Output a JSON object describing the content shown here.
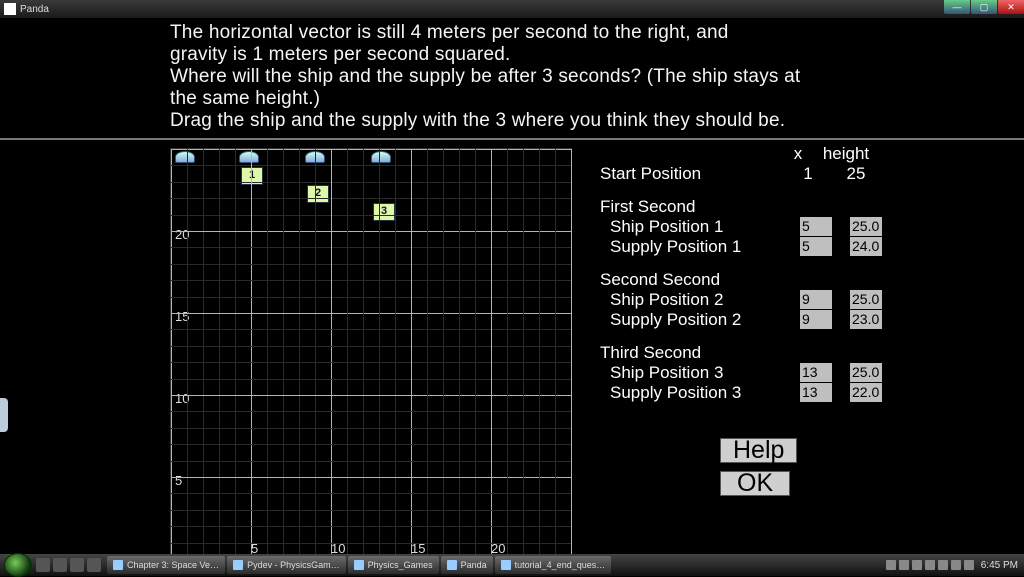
{
  "window": {
    "title": "Panda"
  },
  "question": {
    "line1": "The horizontal vector is still 4  meters per second to the right, and",
    "line2": "gravity is 1  meters per second squared.",
    "line3": "Where will the ship and the supply be after 3 seconds?  (The ship stays at",
    "line4": "the same height.)",
    "line5": "Drag the ship and the supply with the 3 where you think they should be."
  },
  "grid": {
    "y_labels": [
      "20",
      "15",
      "10",
      "5"
    ],
    "x_labels": [
      "5",
      "10",
      "15",
      "20"
    ],
    "tokens": {
      "t1": "1",
      "t2": "2",
      "t3": "3"
    }
  },
  "panel": {
    "col_x": "x",
    "col_h": "height",
    "start_label": "Start Position",
    "start_x": "1",
    "start_h": "25",
    "sec1": {
      "title": "First Second",
      "ship_label": "Ship Position 1",
      "ship_x": "5",
      "ship_h": "25.0",
      "supply_label": "Supply Position 1",
      "supply_x": "5",
      "supply_h": "24.0"
    },
    "sec2": {
      "title": "Second Second",
      "ship_label": "Ship Position 2",
      "ship_x": "9",
      "ship_h": "25.0",
      "supply_label": "Supply Position 2",
      "supply_x": "9",
      "supply_h": "23.0"
    },
    "sec3": {
      "title": "Third Second",
      "ship_label": "Ship Position 3",
      "ship_x": "13",
      "ship_h": "25.0",
      "supply_label": "Supply Position 3",
      "supply_x": "13",
      "supply_h": "22.0"
    },
    "help": "Help",
    "ok": "OK"
  },
  "taskbar": {
    "items": [
      "Chapter 3: Space Ve…",
      "Pydev - PhysicsGam…",
      "Physics_Games",
      "Panda",
      "tutorial_4_end_ques…"
    ],
    "clock": "6:45 PM"
  }
}
